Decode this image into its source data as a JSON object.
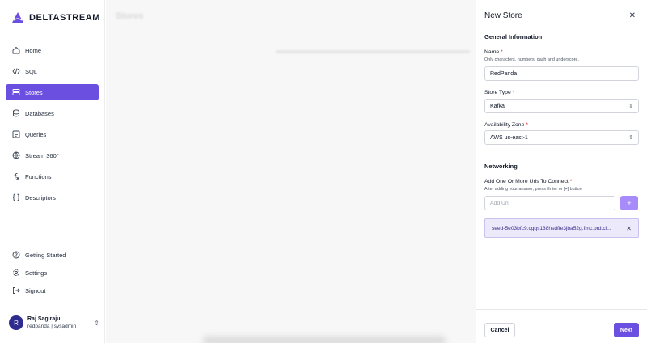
{
  "app": {
    "brand": "DeltaStream"
  },
  "sidebar": {
    "items": [
      {
        "label": "Home",
        "icon": "home-icon"
      },
      {
        "label": "SQL",
        "icon": "code-icon"
      },
      {
        "label": "Stores",
        "icon": "stores-icon",
        "active": true
      },
      {
        "label": "Databases",
        "icon": "database-icon"
      },
      {
        "label": "Queries",
        "icon": "queries-icon"
      },
      {
        "label": "Stream 360°",
        "icon": "globe-icon"
      },
      {
        "label": "Functions",
        "icon": "function-icon"
      },
      {
        "label": "Descriptors",
        "icon": "braces-icon"
      }
    ],
    "bottom_items": [
      {
        "label": "Getting Started",
        "icon": "help-icon"
      },
      {
        "label": "Settings",
        "icon": "gear-icon"
      },
      {
        "label": "Signout",
        "icon": "signout-icon"
      }
    ],
    "user": {
      "initial": "R",
      "name": "Raj Sagiraju",
      "org_role": "redpanda | sysadmin"
    }
  },
  "main": {
    "title": "Stores"
  },
  "drawer": {
    "title": "New Store",
    "close_symbol": "✕",
    "general_section": "General Information",
    "name_label": "Name",
    "name_help": "Only characters, numbers, dash and underscore.",
    "name_value": "RedPanda",
    "store_type_label": "Store Type",
    "store_type_value": "Kafka",
    "availability_zone_label": "Availability Zone",
    "availability_zone_value": "AWS us-east-1",
    "networking_section": "Networking",
    "urls_label": "Add One Or More Urls To Connect",
    "urls_help": "After adding your answer, press Enter or [+] button",
    "url_placeholder": "Add Url",
    "add_button_symbol": "+",
    "url_chips": [
      "seed-5e03bfc9.cgqs138hsdffe3jba52g.fmc.prd.cl..."
    ],
    "cancel_label": "Cancel",
    "next_label": "Next"
  },
  "colors": {
    "accent": "#6b4fe0",
    "accent_light": "#a78bfa",
    "chip_bg": "#ece9fb",
    "required": "#e02424"
  }
}
